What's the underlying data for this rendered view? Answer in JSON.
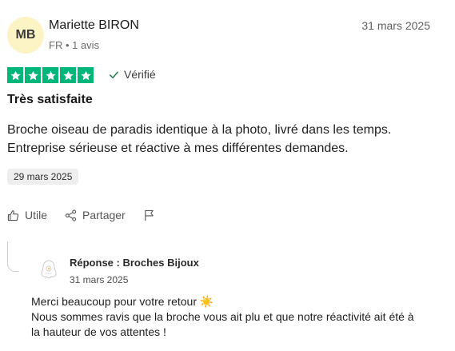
{
  "reviewer": {
    "initials": "MB",
    "name": "Mariette BIRON",
    "meta": "FR • 1 avis"
  },
  "review": {
    "date": "31 mars 2025",
    "rating": 5,
    "rating_max": 5,
    "star_color": "#00b67a",
    "verified_label": "Vérifié",
    "title": "Très satisfaite",
    "body_lines": [
      "Broche oiseau de paradis identique à la photo, livré dans les temps.",
      "Entreprise sérieuse et réactive à mes différentes demandes."
    ],
    "experience_date": "29 mars 2025"
  },
  "actions": {
    "useful_label": "Utile",
    "share_label": "Partager",
    "flag_icon": "flag-icon"
  },
  "reply": {
    "company": "Réponse : Broches Bijoux",
    "date": "31 mars 2025",
    "body_lines": [
      "Merci beaucoup pour votre retour ☀️",
      "Nous sommes ravis que la broche vous ait plu et que notre réactivité ait été à",
      "la hauteur de vos attentes !"
    ]
  }
}
